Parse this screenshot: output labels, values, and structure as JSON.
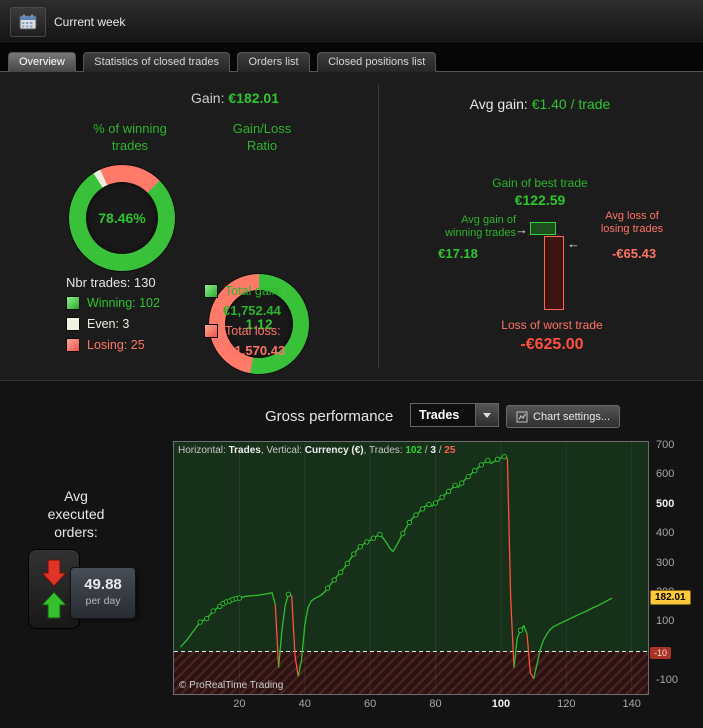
{
  "toolbar": {
    "current_week_label": "Current week"
  },
  "tabs": [
    {
      "label": "Overview"
    },
    {
      "label": "Statistics of closed trades"
    },
    {
      "label": "Orders list"
    },
    {
      "label": "Closed positions list"
    }
  ],
  "stats": {
    "gain_label": "Gain:",
    "gain_value": "€182.01",
    "winning_title_line1": "% of winning",
    "winning_title_line2": "trades",
    "ratio_title_line1": "Gain/Loss",
    "ratio_title_line2": "Ratio",
    "winning_pct": "78.46%",
    "ratio_value": "1.12",
    "nbr_trades_label": "Nbr trades: 130",
    "winning_label": "Winning: 102",
    "even_label": "Even: 3",
    "losing_label": "Losing: 25",
    "total_gain_label": "Total gain:",
    "total_gain_value": "€1,752.44",
    "total_loss_label": "Total loss:",
    "total_loss_value": "-€1,570.43",
    "donut_winning": {
      "winning_pct_value": 78.46,
      "even_pct_value": 2.31,
      "losing_pct_value": 19.23
    },
    "donut_ratio": {
      "gain_pct_value": 52.83,
      "loss_pct_value": 47.17
    },
    "donut_colors": {
      "green": "#3ac13a",
      "white": "#eeeee0",
      "red": "#ff7a68"
    }
  },
  "avg_gain": {
    "label": "Avg gain:",
    "value": "€1.40 / trade",
    "best_trade_label": "Gain of best trade",
    "best_trade_value": "€122.59",
    "avg_win_label_line1": "Avg gain of",
    "avg_win_label_line2": "winning trades",
    "avg_win_value": "€17.18",
    "avg_loss_label_line1": "Avg loss of",
    "avg_loss_label_line2": "losing trades",
    "avg_loss_value": "-€65.43",
    "worst_trade_label": "Loss of worst trade",
    "worst_trade_value": "-€625.00"
  },
  "performance": {
    "title": "Gross performance",
    "dropdown_value": "Trades",
    "settings_label": "Chart settings...",
    "avg_orders_line1": "Avg",
    "avg_orders_line2": "executed",
    "avg_orders_line3": "orders:",
    "avg_orders_value": "49.88",
    "avg_orders_unit": "per day",
    "copyright": "© ProRealTime Trading",
    "legend": {
      "h_label": "Horizontal: ",
      "h_value": "Trades",
      "sep1": ", Vertical: ",
      "v_value": "Currency (€)",
      "sep2": ", Trades: ",
      "winning": "102",
      "slash1": " / ",
      "even": "3",
      "slash2": " / ",
      "losing": "25"
    }
  },
  "chart_data": {
    "type": "line",
    "title": "Gross performance",
    "xlabel": "Trades",
    "ylabel": "Currency (€)",
    "xlim": [
      0,
      145
    ],
    "ylim": [
      -145,
      714
    ],
    "xticks": [
      20,
      40,
      60,
      80,
      100,
      120,
      140
    ],
    "yticks": [
      700,
      600,
      500,
      400,
      300,
      200,
      100,
      -100
    ],
    "bold_xticks": [
      100
    ],
    "bold_yticks": [
      500
    ],
    "zero_line": 0,
    "final_value": 182.01,
    "final_value_label": "182.01",
    "lower_marker": -10,
    "lower_marker_label": "-10",
    "trade_counts": {
      "winning": 102,
      "even": 3,
      "losing": 25
    },
    "colors": {
      "gain_line": "#2fbf2f",
      "loss_line": "#ff5040",
      "gain_bg": "#16301a",
      "loss_bg": "#2a1312",
      "loss_hatch": "#4a221e",
      "grid": "rgba(255,255,255,0.07)"
    },
    "segments": [
      {
        "dir": "gain",
        "points": [
          [
            2,
            15
          ],
          [
            4,
            40
          ],
          [
            6,
            70
          ],
          [
            8,
            100
          ],
          [
            10,
            112
          ],
          [
            12,
            138
          ],
          [
            14,
            154
          ],
          [
            15,
            163
          ],
          [
            16,
            169
          ],
          [
            17,
            172
          ],
          [
            18,
            177
          ],
          [
            19,
            180
          ],
          [
            20,
            182
          ],
          [
            22,
            188
          ],
          [
            24,
            190
          ],
          [
            26,
            192
          ],
          [
            28,
            196
          ],
          [
            30,
            200
          ],
          [
            31,
            160
          ]
        ]
      },
      {
        "dir": "loss",
        "points": [
          [
            31,
            160
          ],
          [
            32,
            -55
          ]
        ]
      },
      {
        "dir": "gain",
        "points": [
          [
            32,
            -55
          ],
          [
            33,
            70
          ],
          [
            34,
            155
          ],
          [
            35,
            195
          ],
          [
            36,
            190
          ]
        ]
      },
      {
        "dir": "loss",
        "points": [
          [
            36,
            190
          ],
          [
            37,
            -15
          ],
          [
            38,
            -85
          ]
        ]
      },
      {
        "dir": "gain",
        "points": [
          [
            38,
            -85
          ],
          [
            39,
            -30
          ],
          [
            40,
            90
          ],
          [
            41,
            150
          ],
          [
            42,
            172
          ],
          [
            43,
            180
          ],
          [
            44,
            186
          ],
          [
            45,
            192
          ],
          [
            46,
            202
          ],
          [
            47,
            216
          ],
          [
            48,
            230
          ],
          [
            49,
            244
          ],
          [
            50,
            258
          ],
          [
            51,
            270
          ],
          [
            52,
            284
          ],
          [
            53,
            300
          ],
          [
            54,
            316
          ],
          [
            55,
            332
          ],
          [
            56,
            346
          ],
          [
            57,
            357
          ],
          [
            58,
            366
          ],
          [
            59,
            373
          ],
          [
            60,
            379
          ],
          [
            61,
            386
          ],
          [
            62,
            393
          ],
          [
            63,
            399
          ],
          [
            64,
            386
          ],
          [
            65,
            371
          ],
          [
            66,
            352
          ],
          [
            67,
            341
          ],
          [
            68,
            360
          ],
          [
            69,
            381
          ],
          [
            70,
            402
          ],
          [
            71,
            421
          ],
          [
            72,
            440
          ],
          [
            73,
            454
          ],
          [
            74,
            465
          ],
          [
            75,
            475
          ],
          [
            76,
            486
          ],
          [
            77,
            496
          ],
          [
            78,
            501
          ],
          [
            79,
            496
          ],
          [
            80,
            506
          ],
          [
            81,
            516
          ],
          [
            82,
            526
          ],
          [
            83,
            536
          ],
          [
            84,
            546
          ],
          [
            85,
            556
          ],
          [
            86,
            566
          ],
          [
            87,
            560
          ],
          [
            88,
            574
          ],
          [
            89,
            585
          ],
          [
            90,
            596
          ],
          [
            91,
            606
          ],
          [
            92,
            616
          ],
          [
            93,
            626
          ],
          [
            94,
            636
          ],
          [
            95,
            645
          ],
          [
            96,
            651
          ],
          [
            97,
            641
          ],
          [
            98,
            648
          ],
          [
            99,
            655
          ],
          [
            100,
            660
          ],
          [
            101,
            664
          ],
          [
            102,
            659
          ]
        ]
      },
      {
        "dir": "loss",
        "points": [
          [
            102,
            659
          ],
          [
            103,
            180
          ],
          [
            104,
            -55
          ]
        ]
      },
      {
        "dir": "gain",
        "points": [
          [
            104,
            -55
          ],
          [
            105,
            45
          ],
          [
            106,
            72
          ],
          [
            107,
            88
          ],
          [
            108,
            60
          ]
        ]
      },
      {
        "dir": "loss",
        "points": [
          [
            108,
            60
          ],
          [
            109,
            -72
          ],
          [
            110,
            -93
          ]
        ]
      },
      {
        "dir": "gain",
        "points": [
          [
            110,
            -93
          ],
          [
            111,
            -45
          ],
          [
            112,
            5
          ],
          [
            113,
            38
          ],
          [
            114,
            58
          ],
          [
            115,
            73
          ],
          [
            116,
            84
          ],
          [
            118,
            95
          ],
          [
            120,
            106
          ],
          [
            122,
            116
          ],
          [
            124,
            127
          ],
          [
            126,
            137
          ],
          [
            128,
            148
          ],
          [
            130,
            158
          ],
          [
            132,
            170
          ],
          [
            134,
            182
          ]
        ]
      }
    ],
    "dots": [
      [
        8,
        100
      ],
      [
        10,
        112
      ],
      [
        12,
        138
      ],
      [
        14,
        154
      ],
      [
        15,
        163
      ],
      [
        16,
        169
      ],
      [
        17,
        172
      ],
      [
        18,
        177
      ],
      [
        19,
        180
      ],
      [
        20,
        182
      ],
      [
        35,
        195
      ],
      [
        47,
        216
      ],
      [
        49,
        244
      ],
      [
        51,
        270
      ],
      [
        53,
        300
      ],
      [
        55,
        332
      ],
      [
        57,
        357
      ],
      [
        59,
        373
      ],
      [
        61,
        386
      ],
      [
        63,
        399
      ],
      [
        70,
        402
      ],
      [
        72,
        440
      ],
      [
        74,
        465
      ],
      [
        76,
        486
      ],
      [
        78,
        501
      ],
      [
        80,
        506
      ],
      [
        82,
        526
      ],
      [
        84,
        546
      ],
      [
        86,
        566
      ],
      [
        88,
        574
      ],
      [
        90,
        596
      ],
      [
        92,
        616
      ],
      [
        94,
        636
      ],
      [
        96,
        651
      ],
      [
        99,
        655
      ],
      [
        101,
        664
      ],
      [
        106,
        72
      ]
    ]
  }
}
